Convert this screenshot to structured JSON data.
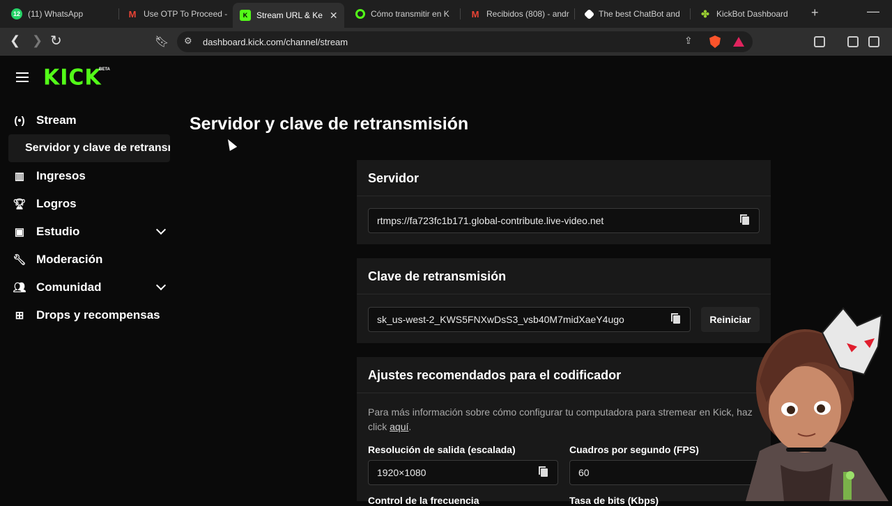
{
  "browser": {
    "tabs": [
      {
        "label": "(11) WhatsApp",
        "badge": "12",
        "color": "#25d366"
      },
      {
        "label": "Use OTP To Proceed -",
        "badge": "M",
        "color": "#ea4335"
      },
      {
        "label": "Stream URL & Ke",
        "badge": "K",
        "color": "#53fc18"
      },
      {
        "label": "Cómo transmitir en K",
        "badge": "",
        "color": "#53fc18"
      },
      {
        "label": "Recibidos (808) - andr",
        "badge": "M",
        "color": "#ea4335"
      },
      {
        "label": "The best ChatBot and",
        "badge": "",
        "color": "#ffffff"
      },
      {
        "label": "KickBot Dashboard",
        "badge": "",
        "color": "#9acd32"
      }
    ],
    "url": "dashboard.kick.com/channel/stream"
  },
  "sidebar": {
    "logo": "KICK",
    "beta": "BETA",
    "items": [
      {
        "label": "Stream"
      },
      {
        "label": "Servidor y clave de retransmisión"
      },
      {
        "label": "Ingresos"
      },
      {
        "label": "Logros"
      },
      {
        "label": "Estudio"
      },
      {
        "label": "Moderación"
      },
      {
        "label": "Comunidad"
      },
      {
        "label": "Drops y recompensas"
      }
    ]
  },
  "main": {
    "title": "Servidor y clave de retransmisión",
    "server": {
      "heading": "Servidor",
      "value": "rtmps://fa723fc1b171.global-contribute.live-video.net"
    },
    "key": {
      "heading": "Clave de retransmisión",
      "value": "sk_us-west-2_KWS5FNXwDsS3_vsb40M7midXaeY4ugo",
      "reset": "Reiniciar"
    },
    "encoder": {
      "heading": "Ajustes recomendados para el codificador",
      "desc": "Para más información sobre cómo configurar tu computadora para stremear en Kick, haz click",
      "link": "aquí",
      "resolution_label": "Resolución de salida (escalada)",
      "resolution_value": "1920×1080",
      "fps_label": "Cuadros por segundo (FPS)",
      "fps_value": "60",
      "rate_control_label": "Control de la frecuencia",
      "bitrate_label": "Tasa de bits (Kbps)"
    }
  }
}
